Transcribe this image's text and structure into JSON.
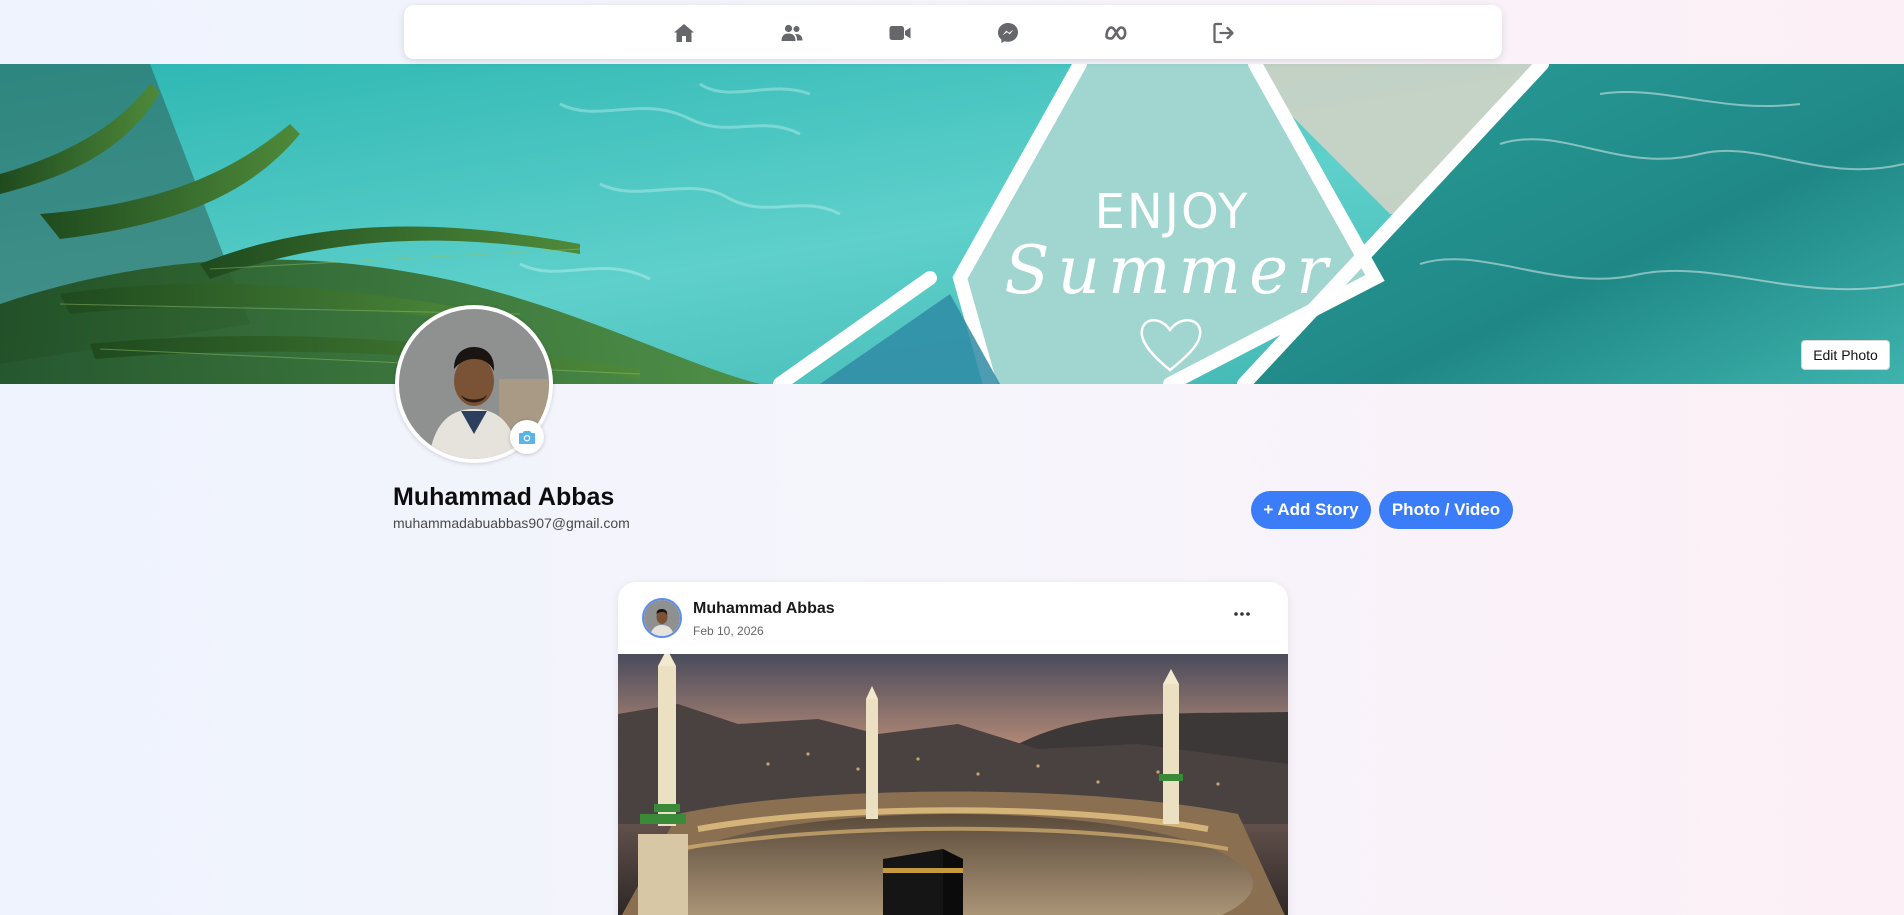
{
  "nav": {
    "items": [
      {
        "name": "home-icon",
        "label": "Home"
      },
      {
        "name": "friends-icon",
        "label": "Friends"
      },
      {
        "name": "video-icon",
        "label": "Video"
      },
      {
        "name": "messenger-icon",
        "label": "Messenger"
      },
      {
        "name": "meta-icon",
        "label": "Meta"
      },
      {
        "name": "logout-icon",
        "label": "Logout"
      }
    ],
    "icon_color": "#65676b"
  },
  "cover": {
    "text_enjoy": "ENJOY",
    "text_summer": "Summer",
    "edit_label": "Edit Photo"
  },
  "profile": {
    "name": "Muhammad Abbas",
    "email": "muhammadabuabbas907@gmail.com",
    "camera_icon": "camera-icon"
  },
  "actions": {
    "add_story_label": "+ Add Story",
    "photo_video_label": "Photo / Video",
    "accent_color": "#3b7df8"
  },
  "post": {
    "author": "Muhammad Abbas",
    "date": "Feb 10, 2026",
    "menu_icon": "more-options-icon"
  }
}
